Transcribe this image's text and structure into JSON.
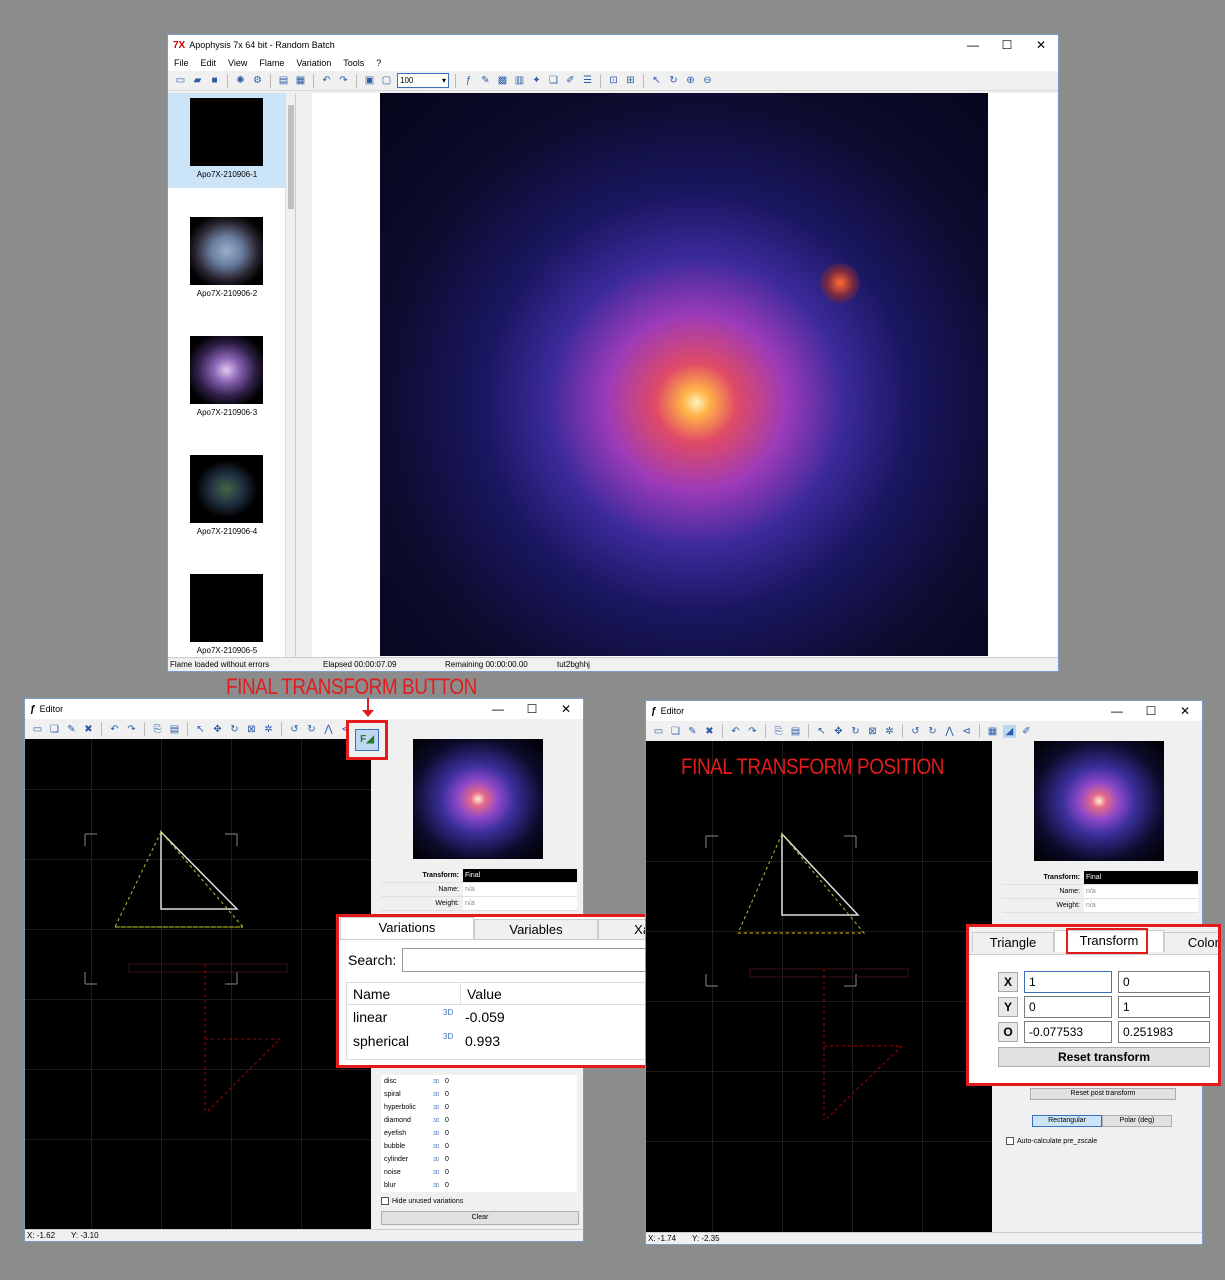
{
  "main_window": {
    "title": "Apophysis 7x 64 bit - Random Batch",
    "menu": [
      "File",
      "Edit",
      "View",
      "Flame",
      "Variation",
      "Tools",
      "?"
    ],
    "zoom_value": "100",
    "thumbnails": [
      {
        "label": "Apo7X-210906-1",
        "selected": true
      },
      {
        "label": "Apo7X-210906-2",
        "selected": false
      },
      {
        "label": "Apo7X-210906-3",
        "selected": false
      },
      {
        "label": "Apo7X-210906-4",
        "selected": false
      },
      {
        "label": "Apo7X-210906-5",
        "selected": false
      }
    ],
    "status": {
      "message": "Flame loaded without errors",
      "elapsed": "Elapsed 00:00:07.09",
      "remaining": "Remaining 00:00:00.00",
      "name": "tut2bghhj"
    }
  },
  "annotations": {
    "final_transform_button": "FINAL TRANSFORM BUTTON",
    "final_transform_position": "FINAL TRANSFORM POSITION",
    "color": "#e31b1b"
  },
  "editor_left": {
    "title": "Editor",
    "transform_label": "Transform:",
    "transform_value": "Final",
    "name_label": "Name:",
    "name_value": "n/a",
    "weight_label": "Weight:",
    "weight_value": "n/a",
    "tabs": [
      "Variations",
      "Variables",
      "Xaos"
    ],
    "search_label": "Search:",
    "search_value": "",
    "columns": [
      "Name",
      "Value"
    ],
    "variations": [
      {
        "name": "linear",
        "value": "-0.059"
      },
      {
        "name": "spherical",
        "value": "0.993"
      }
    ],
    "small_variations": [
      {
        "name": "disc",
        "value": "0"
      },
      {
        "name": "spiral",
        "value": "0"
      },
      {
        "name": "hyperbolic",
        "value": "0"
      },
      {
        "name": "diamond",
        "value": "0"
      },
      {
        "name": "eyefish",
        "value": "0"
      },
      {
        "name": "bubble",
        "value": "0"
      },
      {
        "name": "cylinder",
        "value": "0"
      },
      {
        "name": "noise",
        "value": "0"
      },
      {
        "name": "blur",
        "value": "0"
      }
    ],
    "hide_unused": "Hide unused variations",
    "clear_label": "Clear",
    "status_x": "X: -1.62",
    "status_y": "Y: -3.10"
  },
  "editor_right": {
    "title": "Editor",
    "transform_label": "Transform:",
    "transform_value": "Final",
    "name_label": "Name:",
    "name_value": "n/a",
    "weight_label": "Weight:",
    "weight_value": "n/a",
    "tabs": [
      "Triangle",
      "Transform",
      "Color"
    ],
    "rows": [
      {
        "label": "X",
        "a": "1",
        "b": "0"
      },
      {
        "label": "Y",
        "a": "0",
        "b": "1"
      },
      {
        "label": "O",
        "a": "-0.077533",
        "b": "0.251983"
      }
    ],
    "reset_transform": "Reset transform",
    "reset_post_transform": "Reset post transform",
    "rectangular": "Rectangular",
    "polar": "Polar (deg)",
    "auto_calc": "Auto-calculate pre_zscale",
    "status_x": "X: -1.74",
    "status_y": "Y: -2.35"
  }
}
